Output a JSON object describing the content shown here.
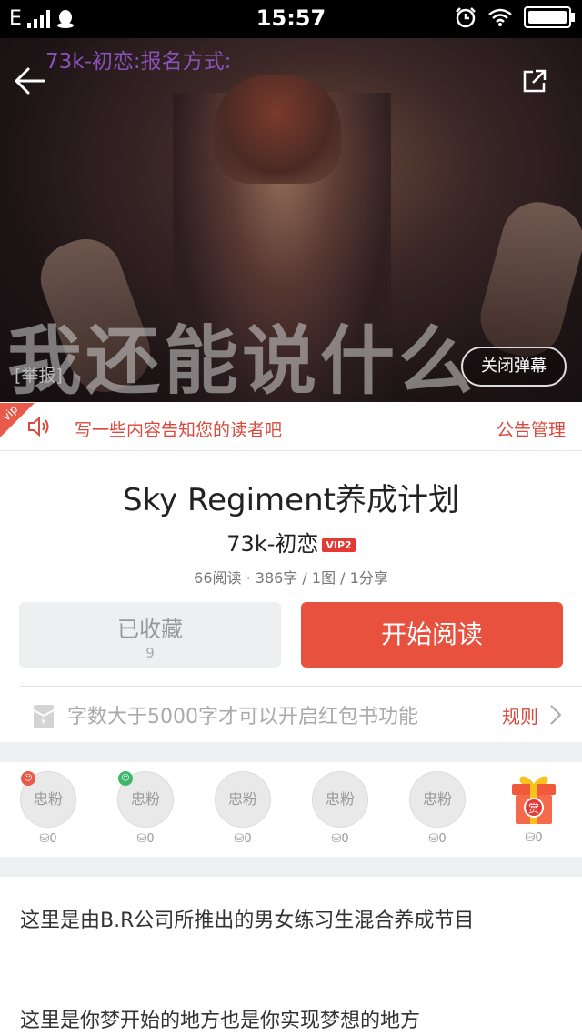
{
  "status_bar": {
    "network": "E",
    "time": "15:57"
  },
  "hero": {
    "danmaku_text": "73k-初恋:报名方式:",
    "image_caption": "我还能说什么",
    "report_label": "[举报]",
    "close_danmaku_label": "关闭弹幕"
  },
  "notice": {
    "vip_tag": "vip",
    "text": "写一些内容告知您的读者吧",
    "manage_label": "公告管理"
  },
  "book": {
    "title": "Sky Regiment养成计划",
    "author": "73k-初恋",
    "vip_level": "VIP2",
    "stats": "66阅读 · 386字 / 1图 / 1分享"
  },
  "actions": {
    "collect_label": "已收藏",
    "collect_count": "9",
    "read_label": "开始阅读"
  },
  "red_packet": {
    "text": "字数大于5000字才可以开启红包书功能",
    "rule_label": "规则"
  },
  "fans": {
    "items": [
      {
        "label": "忠粉",
        "coins": "0"
      },
      {
        "label": "忠粉",
        "coins": "0"
      },
      {
        "label": "忠粉",
        "coins": "0"
      },
      {
        "label": "忠粉",
        "coins": "0"
      },
      {
        "label": "忠粉",
        "coins": "0"
      }
    ],
    "gift_label": "赏",
    "gift_coins": "0"
  },
  "content": {
    "paragraphs": [
      "这里是由B.R公司所推出的男女练习生混合养成节目",
      "这里是你梦开始的地方也是你实现梦想的地方"
    ]
  },
  "colors": {
    "accent": "#e7513d",
    "notice": "#d94a3e",
    "danmaku": "#8a52b8"
  }
}
